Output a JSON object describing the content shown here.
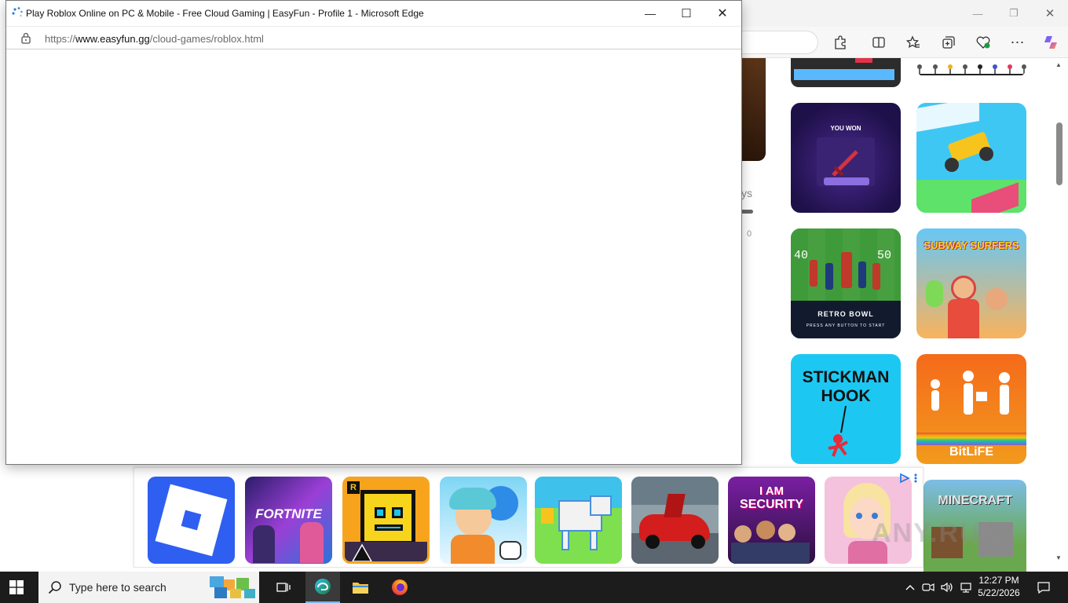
{
  "popup_window": {
    "title": "Play Roblox Online on PC & Mobile - Free Cloud Gaming | EasyFun - Profile 1 - Microsoft Edge",
    "url_prefix": "https://",
    "url_domain": "www.easyfun.gg",
    "url_path": "/cloud-games/roblox.html",
    "controls": {
      "minimize": "—",
      "maximize": "☐",
      "close": "✕"
    }
  },
  "background_window": {
    "controls": {
      "minimize": "—",
      "restore": "❐",
      "close": "✕"
    },
    "toolbar_icons": [
      "read-aloud-icon",
      "favorite-star-icon",
      "extensions-icon",
      "split-screen-icon",
      "favorites-icon",
      "collections-icon",
      "browser-essentials-icon",
      "more-icon",
      "copilot-icon"
    ],
    "partial_text_ys": "ys",
    "partial_text_zero": "0",
    "game_tiles": [
      {
        "name": "blade-game",
        "caption": "YOU WON"
      },
      {
        "name": "monster-truck"
      },
      {
        "name": "retro-bowl",
        "caption": "RETRO BOWL",
        "sub": "PRESS ANY BUTTON TO START",
        "left_num": "40",
        "right_num": "50"
      },
      {
        "name": "subway-surfers",
        "caption": "SUBWAY SURFERS"
      },
      {
        "name": "stickman-hook",
        "caption_line1": "STICKMAN",
        "caption_line2": "HOOK"
      },
      {
        "name": "bitlife",
        "caption": "BitLiFE"
      },
      {
        "name": "minecraft",
        "caption": "MINECRAFT"
      }
    ]
  },
  "ad_bar": {
    "tiles": [
      {
        "name": "roblox"
      },
      {
        "name": "fortnite",
        "caption": "FORTNITE"
      },
      {
        "name": "geometry-dash",
        "badge": "R"
      },
      {
        "name": "toca-world"
      },
      {
        "name": "blocky-dog"
      },
      {
        "name": "red-supercar"
      },
      {
        "name": "i-am-security",
        "caption_line1": "I AM",
        "caption_line2": "SECURITY"
      },
      {
        "name": "hair-salon"
      }
    ]
  },
  "watermark": "ANY.RUN",
  "taskbar": {
    "search_placeholder": "Type here to search",
    "time": "12:27 PM",
    "date": "5/22/2026"
  }
}
